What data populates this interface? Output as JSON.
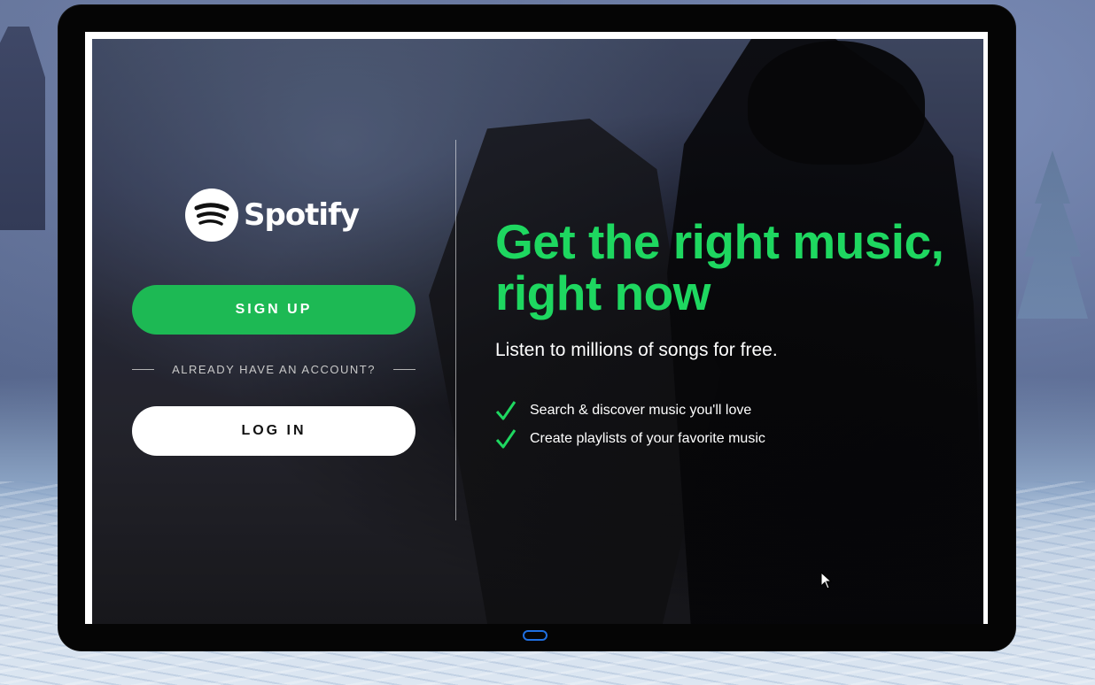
{
  "brand": {
    "name": "Spotify",
    "green": "#1db954",
    "headline_green": "#1ed760"
  },
  "auth": {
    "signup_label": "SIGN UP",
    "divider_text": "ALREADY HAVE AN ACCOUNT?",
    "login_label": "LOG IN"
  },
  "hero": {
    "headline": "Get the right music, right now",
    "subhead": "Listen to millions of songs for free."
  },
  "features": [
    {
      "icon": "check-icon",
      "text": "Search & discover music you'll love"
    },
    {
      "icon": "check-icon",
      "text": "Create playlists of your favorite music"
    }
  ]
}
